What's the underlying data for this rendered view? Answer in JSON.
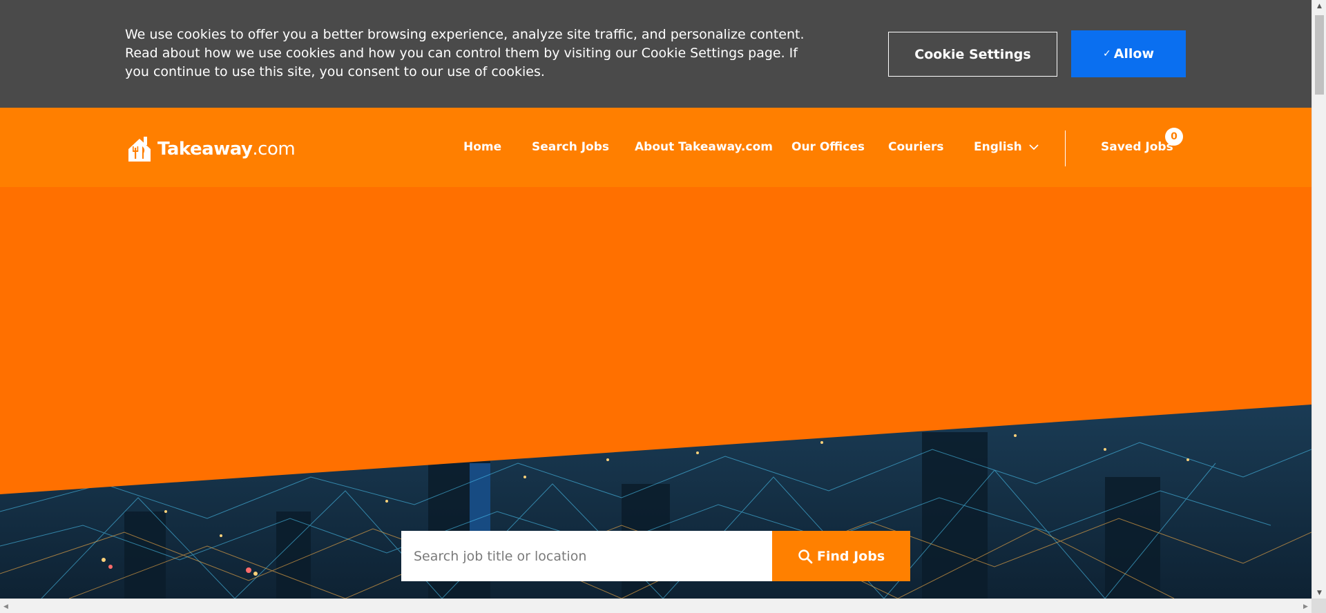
{
  "cookie_bar": {
    "message": "We use cookies to offer you a better browsing experience, analyze site traffic, and personalize content. Read about how we use cookies and how you can control them by visiting our Cookie Settings page. If you continue to use this site, you consent to our use of cookies.",
    "settings_label": "Cookie Settings",
    "allow_label": "Allow",
    "allow_icon": "check-icon",
    "background": "#4a4a4a",
    "allow_color": "#0a6ff0"
  },
  "header": {
    "logo_text_bold": "Takeaway",
    "logo_text_suffix": ".com",
    "logo_icon": "house-fork-knife-icon",
    "background": "#ff7f00",
    "nav": [
      {
        "label": "Home"
      },
      {
        "label": "Search Jobs"
      },
      {
        "label": "About Takeaway.com"
      },
      {
        "label": "Our Offices"
      },
      {
        "label": "Couriers"
      }
    ],
    "language": {
      "label": "English",
      "icon": "chevron-down-icon"
    },
    "saved_jobs": {
      "label": "Saved Jobs",
      "count": "0"
    }
  },
  "hero": {
    "accent": "#ff7000",
    "background_image": "night city skyline with network lines"
  },
  "search": {
    "placeholder": "Search job title or location",
    "value": "",
    "button_label": "Find Jobs",
    "button_icon": "search-icon",
    "button_color": "#ff8000"
  },
  "scrollbars": {
    "up_icon": "arrow-up-icon",
    "down_icon": "arrow-down-icon",
    "left_icon": "arrow-left-icon",
    "right_icon": "arrow-right-icon"
  }
}
